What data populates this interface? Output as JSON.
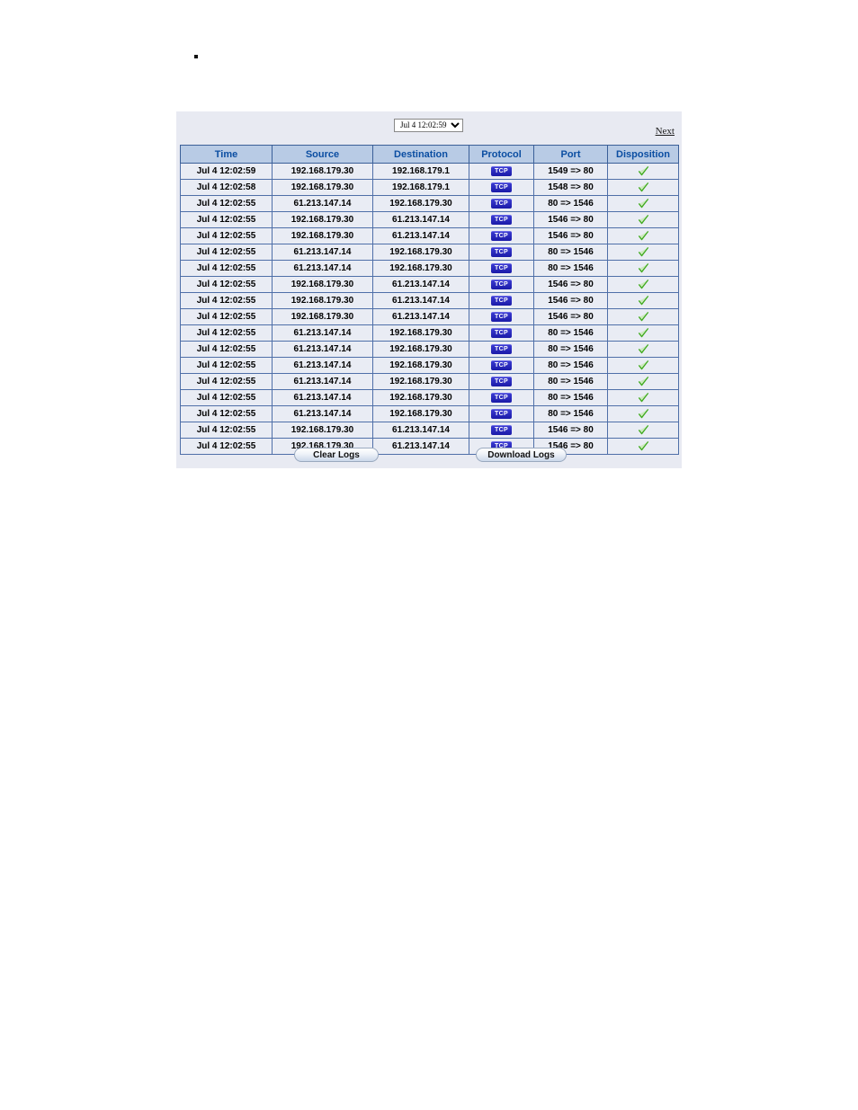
{
  "page": {
    "bullet_marker": "▪"
  },
  "panel": {
    "time_filter": {
      "selected": "Jul 4 12:02:59",
      "options": [
        "Jul 4 12:02:59"
      ]
    },
    "next_link_label": "Next",
    "table": {
      "headers": [
        "Time",
        "Source",
        "Destination",
        "Protocol",
        "Port",
        "Disposition"
      ],
      "rows": [
        {
          "time": "Jul 4 12:02:59",
          "source": "192.168.179.30",
          "destination": "192.168.179.1",
          "protocol": "TCP",
          "port": "1549 => 80",
          "disposition": "allowed-check-icon"
        },
        {
          "time": "Jul 4 12:02:58",
          "source": "192.168.179.30",
          "destination": "192.168.179.1",
          "protocol": "TCP",
          "port": "1548 => 80",
          "disposition": "allowed-check-icon"
        },
        {
          "time": "Jul 4 12:02:55",
          "source": "61.213.147.14",
          "destination": "192.168.179.30",
          "protocol": "TCP",
          "port": "80 => 1546",
          "disposition": "allowed-check-icon"
        },
        {
          "time": "Jul 4 12:02:55",
          "source": "192.168.179.30",
          "destination": "61.213.147.14",
          "protocol": "TCP",
          "port": "1546 => 80",
          "disposition": "allowed-check-icon"
        },
        {
          "time": "Jul 4 12:02:55",
          "source": "192.168.179.30",
          "destination": "61.213.147.14",
          "protocol": "TCP",
          "port": "1546 => 80",
          "disposition": "allowed-check-icon"
        },
        {
          "time": "Jul 4 12:02:55",
          "source": "61.213.147.14",
          "destination": "192.168.179.30",
          "protocol": "TCP",
          "port": "80 => 1546",
          "disposition": "allowed-check-icon"
        },
        {
          "time": "Jul 4 12:02:55",
          "source": "61.213.147.14",
          "destination": "192.168.179.30",
          "protocol": "TCP",
          "port": "80 => 1546",
          "disposition": "allowed-check-icon"
        },
        {
          "time": "Jul 4 12:02:55",
          "source": "192.168.179.30",
          "destination": "61.213.147.14",
          "protocol": "TCP",
          "port": "1546 => 80",
          "disposition": "allowed-check-icon"
        },
        {
          "time": "Jul 4 12:02:55",
          "source": "192.168.179.30",
          "destination": "61.213.147.14",
          "protocol": "TCP",
          "port": "1546 => 80",
          "disposition": "allowed-check-icon"
        },
        {
          "time": "Jul 4 12:02:55",
          "source": "192.168.179.30",
          "destination": "61.213.147.14",
          "protocol": "TCP",
          "port": "1546 => 80",
          "disposition": "allowed-check-icon"
        },
        {
          "time": "Jul 4 12:02:55",
          "source": "61.213.147.14",
          "destination": "192.168.179.30",
          "protocol": "TCP",
          "port": "80 => 1546",
          "disposition": "allowed-check-icon"
        },
        {
          "time": "Jul 4 12:02:55",
          "source": "61.213.147.14",
          "destination": "192.168.179.30",
          "protocol": "TCP",
          "port": "80 => 1546",
          "disposition": "allowed-check-icon"
        },
        {
          "time": "Jul 4 12:02:55",
          "source": "61.213.147.14",
          "destination": "192.168.179.30",
          "protocol": "TCP",
          "port": "80 => 1546",
          "disposition": "allowed-check-icon"
        },
        {
          "time": "Jul 4 12:02:55",
          "source": "61.213.147.14",
          "destination": "192.168.179.30",
          "protocol": "TCP",
          "port": "80 => 1546",
          "disposition": "allowed-check-icon"
        },
        {
          "time": "Jul 4 12:02:55",
          "source": "61.213.147.14",
          "destination": "192.168.179.30",
          "protocol": "TCP",
          "port": "80 => 1546",
          "disposition": "allowed-check-icon"
        },
        {
          "time": "Jul 4 12:02:55",
          "source": "61.213.147.14",
          "destination": "192.168.179.30",
          "protocol": "TCP",
          "port": "80 => 1546",
          "disposition": "allowed-check-icon"
        },
        {
          "time": "Jul 4 12:02:55",
          "source": "192.168.179.30",
          "destination": "61.213.147.14",
          "protocol": "TCP",
          "port": "1546 => 80",
          "disposition": "allowed-check-icon"
        },
        {
          "time": "Jul 4 12:02:55",
          "source": "192.168.179.30",
          "destination": "61.213.147.14",
          "protocol": "TCP",
          "port": "1546 => 80",
          "disposition": "allowed-check-icon"
        }
      ]
    },
    "buttons": {
      "clear_logs_label": "Clear Logs",
      "download_logs_label": "Download Logs"
    }
  },
  "colors": {
    "panel_background": "#e8eaf2",
    "header_background": "#b8cbe5",
    "header_text": "#0b4ea2",
    "cell_background": "#e9ecf4",
    "border": "#4f6fa8",
    "protocol_badge": "#1a1aa8",
    "disposition_check": "#3faa1e"
  }
}
